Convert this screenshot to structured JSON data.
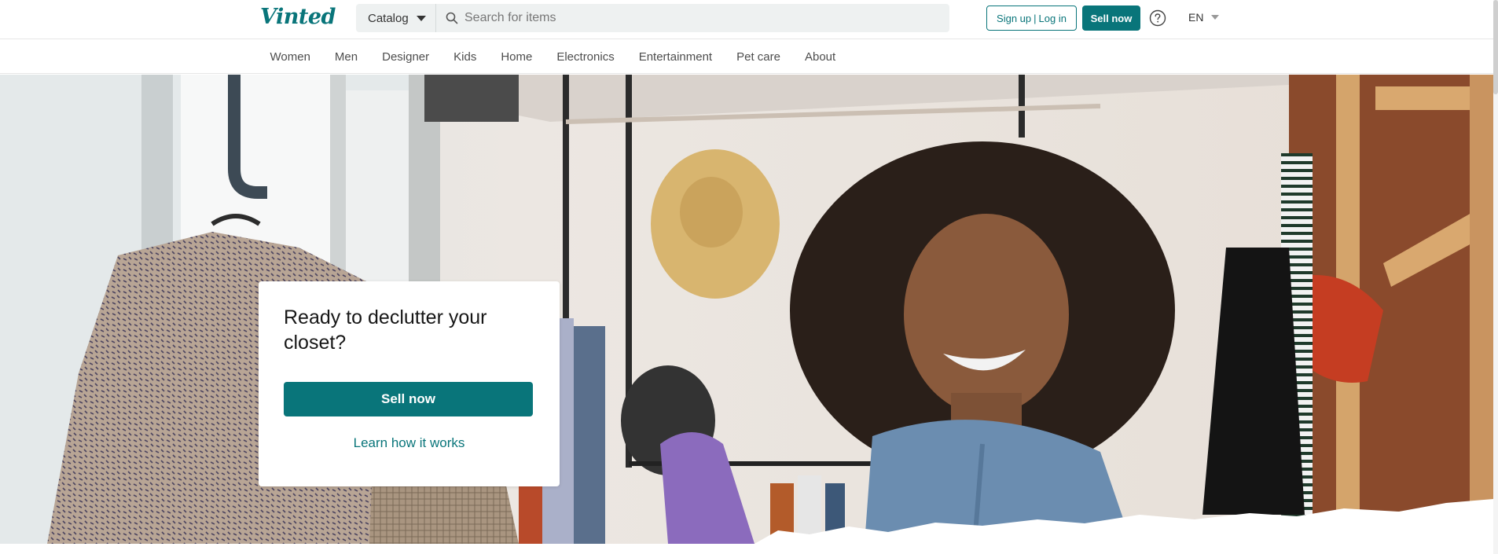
{
  "brand": {
    "name": "Vinted",
    "accent": "#09757a"
  },
  "header": {
    "catalog_label": "Catalog",
    "search_placeholder": "Search for items",
    "signup_label": "Sign up",
    "separator": "|",
    "login_label": "Log in",
    "sell_now_label": "Sell now",
    "help_icon": "question-circle-icon",
    "language": "EN"
  },
  "categories": [
    {
      "label": "Women"
    },
    {
      "label": "Men"
    },
    {
      "label": "Designer"
    },
    {
      "label": "Kids"
    },
    {
      "label": "Home"
    },
    {
      "label": "Electronics"
    },
    {
      "label": "Entertainment"
    },
    {
      "label": "Pet care"
    },
    {
      "label": "About"
    }
  ],
  "hero": {
    "title": "Ready to declutter your closet?",
    "primary_button": "Sell now",
    "secondary_link": "Learn how it works"
  }
}
